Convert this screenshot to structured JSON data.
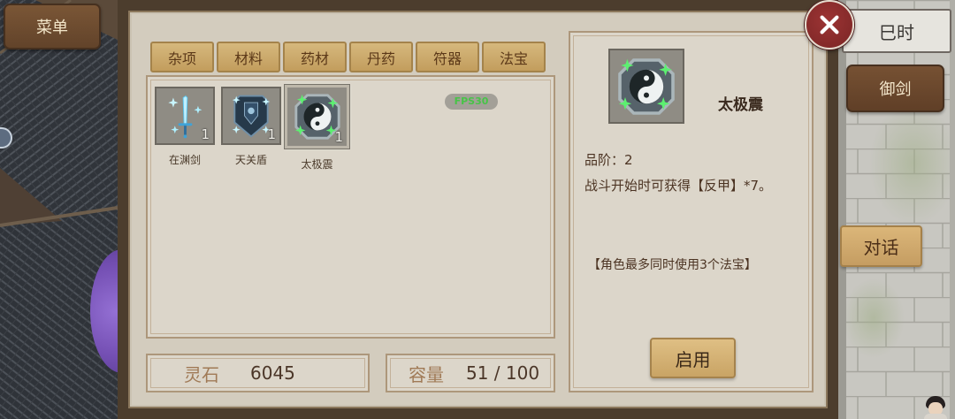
{
  "hud": {
    "menu_label": "菜单",
    "time_label": "巳时",
    "fly_label": "御剑",
    "talk_label": "对话"
  },
  "inventory": {
    "close_icon": "close-icon",
    "tabs": [
      "杂项",
      "材料",
      "药材",
      "丹药",
      "符器",
      "法宝"
    ],
    "items": [
      {
        "name": "在渊剑",
        "count": "1",
        "icon": "sword-icon",
        "selected": false
      },
      {
        "name": "天关盾",
        "count": "1",
        "icon": "shield-icon",
        "selected": false
      },
      {
        "name": "太极震",
        "count": "1",
        "icon": "taiji-icon",
        "selected": true
      }
    ],
    "fps_badge": "FPS30",
    "spirit_stone": {
      "label": "灵石",
      "value": "6045"
    },
    "capacity": {
      "label": "容量",
      "value": "51 / 100"
    }
  },
  "detail": {
    "icon": "taiji-icon",
    "name": "太极震",
    "grade": "品阶：2",
    "effect": "战斗开始时可获得【反甲】*7。",
    "note": "【角色最多同时使用3个法宝】",
    "action_label": "启用"
  },
  "colors": {
    "frame": "#4c3d2d",
    "panel_bg": "#d3ccbe",
    "tab_gold": "#c9a865",
    "button_brown": "#6b4a2d",
    "close_red": "#8a2c2c",
    "text_brown": "#4b3322",
    "fps_green": "#47c447"
  }
}
